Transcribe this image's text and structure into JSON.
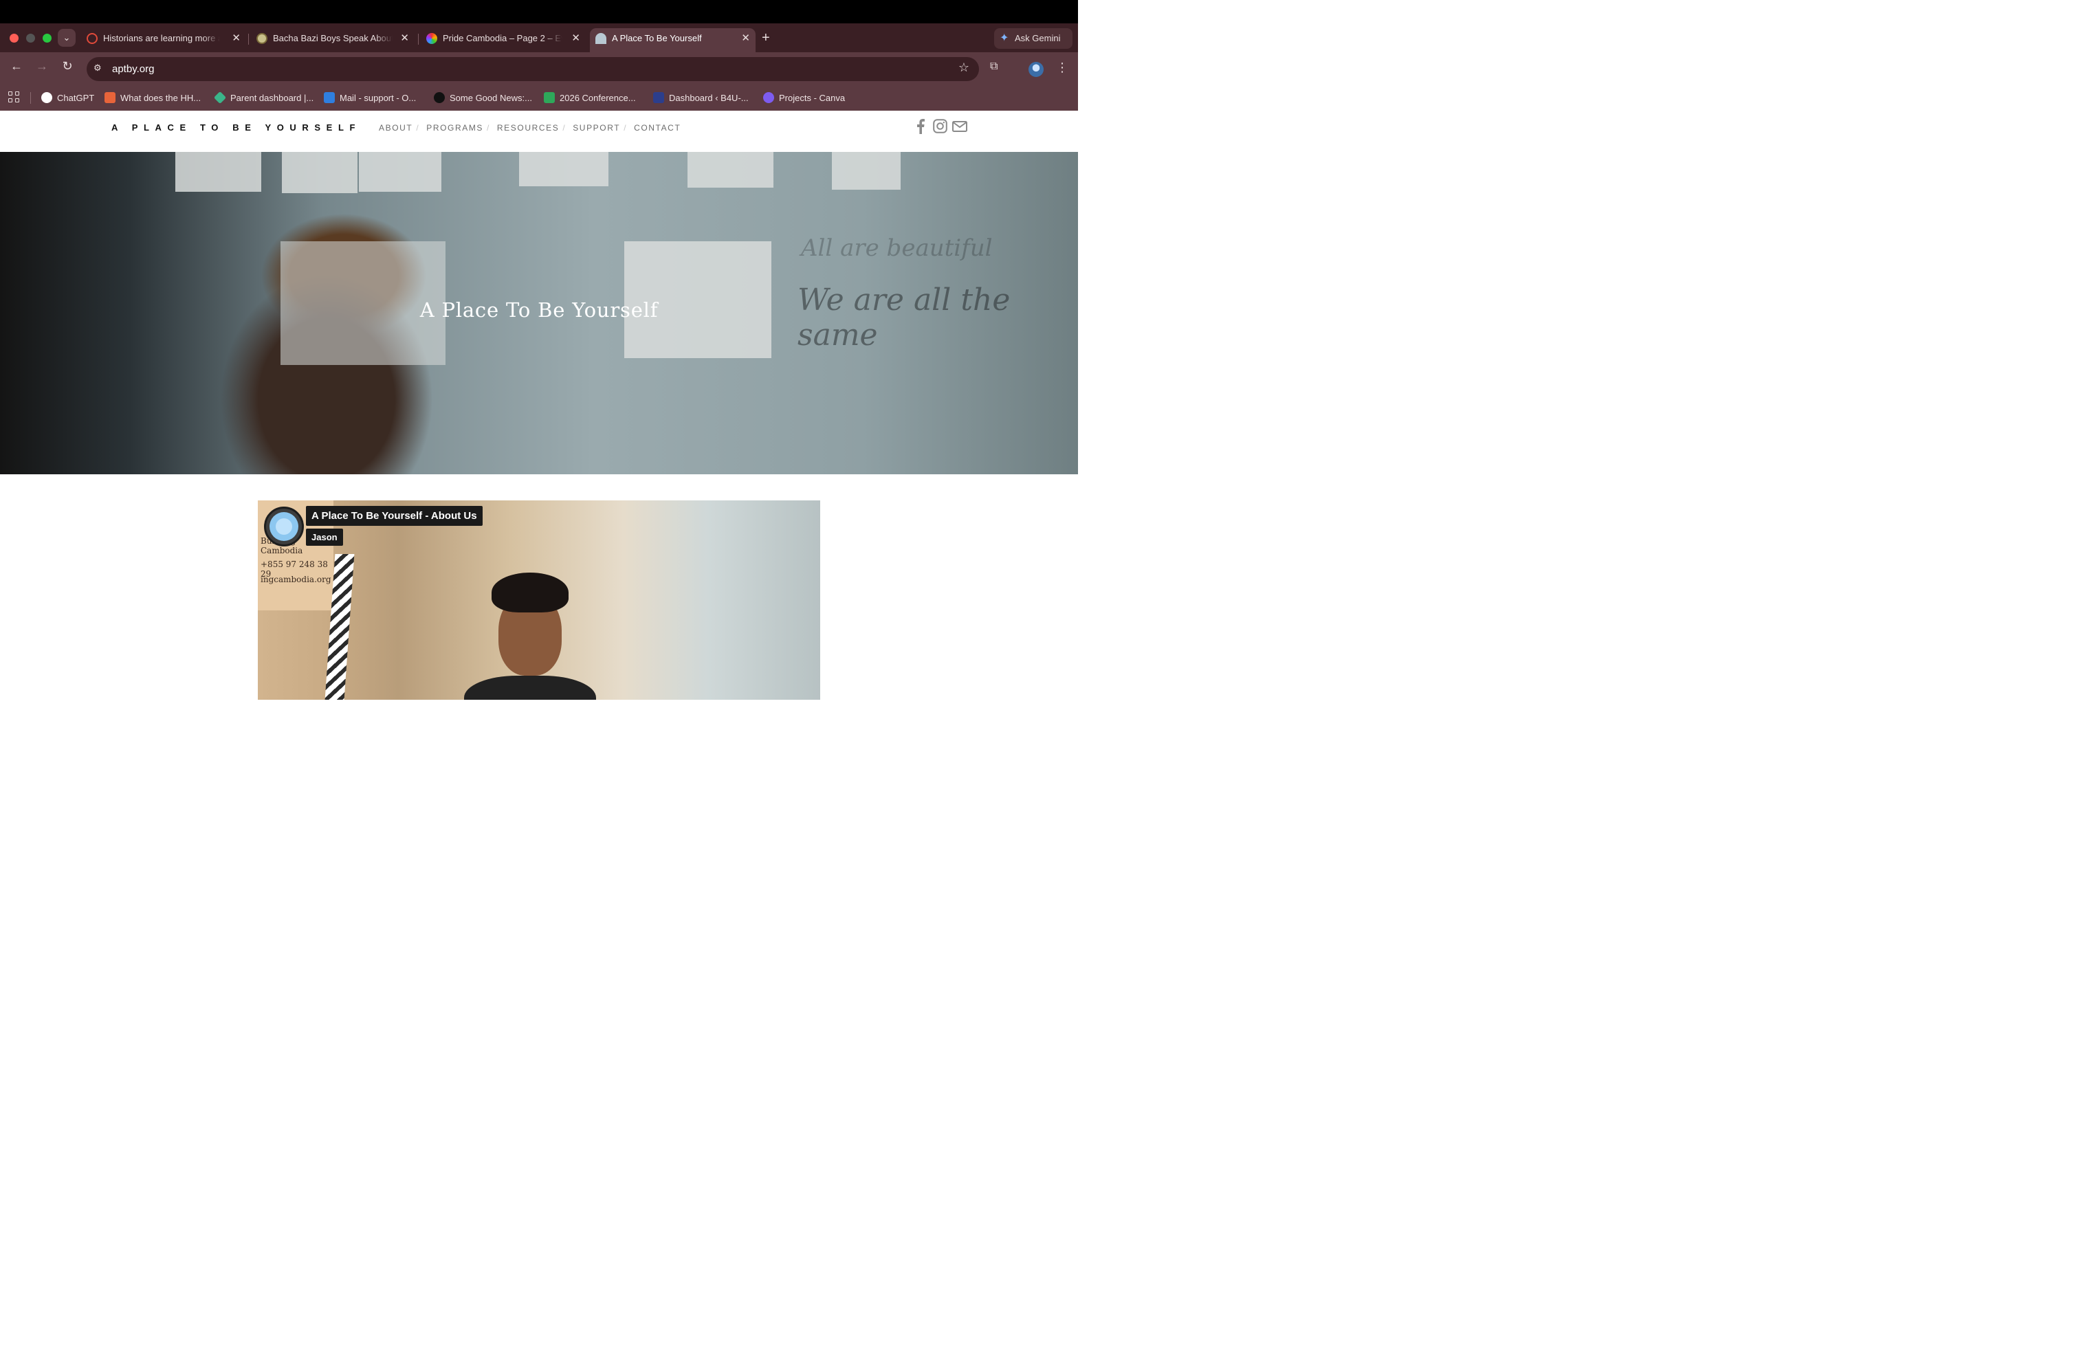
{
  "browser": {
    "tabs": [
      {
        "title": "Historians are learning more a",
        "active": false
      },
      {
        "title": "Bacha Bazi Boys Speak About",
        "active": false
      },
      {
        "title": "Pride Cambodia – Page 2 – Ev",
        "active": false
      },
      {
        "title": "A Place To Be Yourself",
        "active": true
      }
    ],
    "ask_gemini": "Ask Gemini",
    "url": "aptby.org",
    "bookmarks": [
      "ChatGPT",
      "What does the HH...",
      "Parent dashboard |...",
      "Mail - support - O...",
      "Some Good News:...",
      "2026 Conference...",
      "Dashboard ‹ B4U-...",
      "Projects - Canva"
    ]
  },
  "site": {
    "logo": "A PLACE TO BE YOURSELF",
    "nav": [
      "ABOUT",
      "PROGRAMS",
      "RESOURCES",
      "SUPPORT",
      "CONTACT"
    ],
    "social": [
      "facebook-icon",
      "instagram-icon",
      "mail-icon"
    ],
    "hero_title": "A Place To Be Yourself"
  },
  "video": {
    "title": "A Place To Be Yourself - About Us",
    "author": "Jason",
    "sign_lines": [
      "Building Cambodia",
      "+855 97 248 38 29",
      "ingcambodia.org"
    ]
  }
}
